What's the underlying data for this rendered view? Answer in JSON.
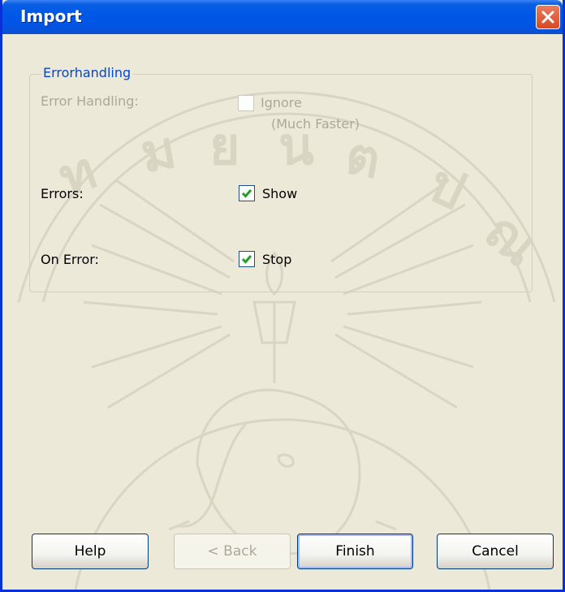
{
  "window": {
    "title": "Import"
  },
  "groupbox": {
    "legend": "Errorhandling",
    "rows": [
      {
        "label": "Error Handling:",
        "option": "Ignore",
        "note": "(Much Faster)",
        "checked": false,
        "enabled": false
      },
      {
        "label": "Errors:",
        "option": "Show",
        "checked": true,
        "enabled": true
      },
      {
        "label": "On Error:",
        "option": "Stop",
        "checked": true,
        "enabled": true
      }
    ]
  },
  "buttons": {
    "help": "Help",
    "back": "< Back",
    "finish": "Finish",
    "cancel": "Cancel"
  },
  "colors": {
    "title_bar": "#0058e6",
    "legend_text": "#0046d5",
    "checkmark": "#21a121",
    "close_button": "#d54a25"
  },
  "icons": {
    "close": "close-x-icon",
    "check": "checkmark-icon"
  }
}
